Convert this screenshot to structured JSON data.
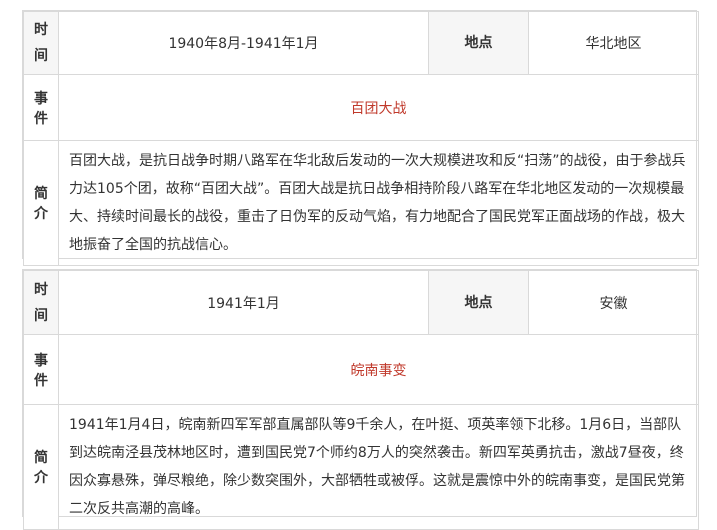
{
  "labels": {
    "time": [
      "时",
      "间"
    ],
    "event": [
      "事",
      "件"
    ],
    "intro": [
      "简",
      "介"
    ],
    "place": "地点"
  },
  "entries": [
    {
      "time": "1940年8月-1941年1月",
      "place": "华北地区",
      "event": "百团大战",
      "intro": "百团大战，是抗日战争时期八路军在华北敌后发动的一次大规模进攻和反“扫荡”的战役，由于参战兵力达105个团，故称“百团大战”。百团大战是抗日战争相持阶段八路军在华北地区发动的一次规模最大、持续时间最长的战役，重击了日伪军的反动气焰，有力地配合了国民党军正面战场的作战，极大地振奋了全国的抗战信心。"
    },
    {
      "time": "1941年1月",
      "place": "安徽",
      "event": "皖南事变",
      "intro": "1941年1月4日，皖南新四军军部直属部队等9千余人，在叶挺、项英率领下北移。1月6日，当部队到达皖南泾县茂林地区时，遭到国民党7个师约8万人的突然袭击。新四军英勇抗击，激战7昼夜，终因众寡悬殊，弹尽粮绝，除少数突围外，大部牺牲或被俘。这就是震惊中外的皖南事变，是国民党第二次反共高潮的高峰。"
    }
  ],
  "colors": {
    "event_link": "#c0392b",
    "border": "#d9d9d9",
    "header_bg": "#f6f6f6"
  }
}
